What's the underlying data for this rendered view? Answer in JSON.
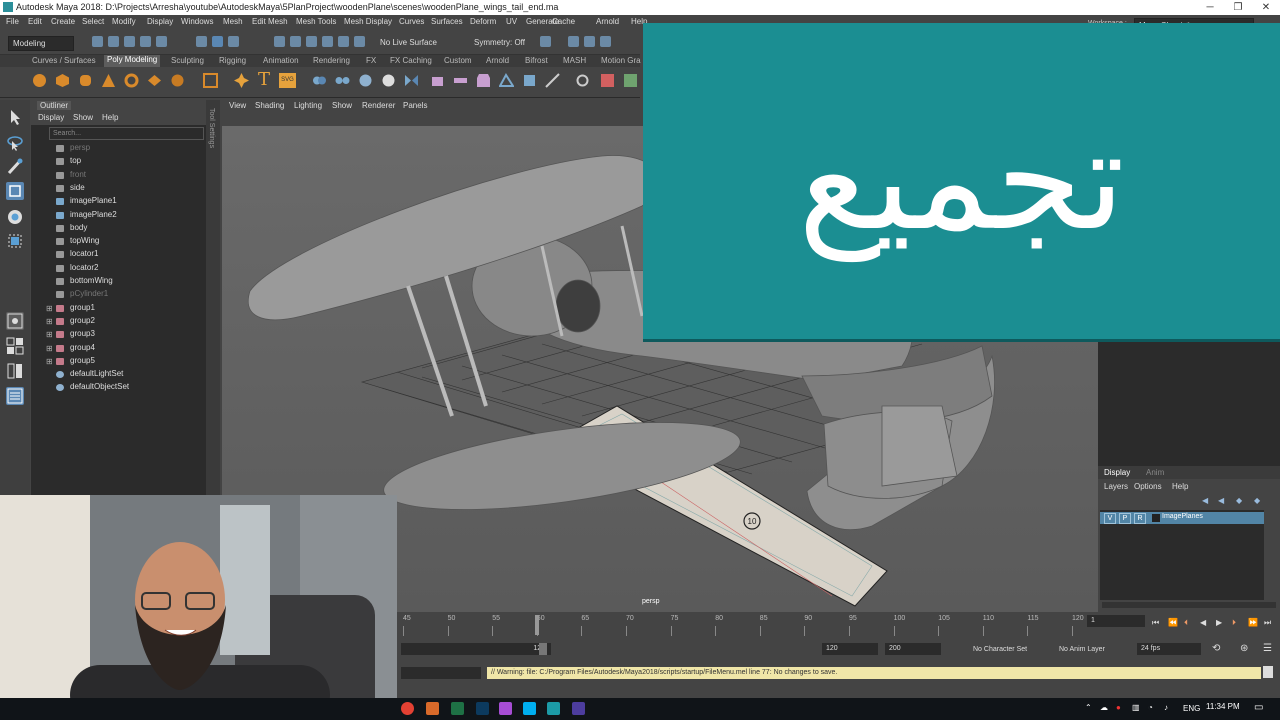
{
  "window": {
    "title": "Autodesk Maya 2018: D:\\Projects\\Arresha\\youtube\\AutodeskMaya\\5PlanProject\\woodenPlane\\scenes\\woodenPlane_wings_tail_end.ma"
  },
  "menubar": {
    "items": [
      "File",
      "Edit",
      "Create",
      "Select",
      "Modify",
      "Display",
      "Windows",
      "Mesh",
      "Edit Mesh",
      "Mesh Tools",
      "Mesh Display",
      "Curves",
      "Surfaces",
      "Deform",
      "UV",
      "Generate",
      "Cache",
      "Arnold",
      "Help"
    ]
  },
  "workspace": {
    "label": "Workspace :",
    "value": "Maya Classic*"
  },
  "toolbar": {
    "mode": "Modeling",
    "live_surface": "No Live Surface",
    "symmetry": "Symmetry: Off"
  },
  "shelf": {
    "tabs": [
      "Curves / Surfaces",
      "Poly Modeling",
      "Sculpting",
      "Rigging",
      "Animation",
      "Rendering",
      "FX",
      "FX Caching",
      "Custom",
      "Arnold",
      "Bifrost",
      "MASH",
      "Motion Gra"
    ],
    "active": "Poly Modeling",
    "svg_label": "SVG",
    "type_label": "T"
  },
  "outliner": {
    "tab": "Outliner",
    "menu": [
      "Display",
      "Show",
      "Help"
    ],
    "search_placeholder": "Search...",
    "items": [
      {
        "name": "persp",
        "icon": "camera-icon",
        "dim": true,
        "expand": false
      },
      {
        "name": "top",
        "icon": "camera-icon",
        "dim": false,
        "expand": false
      },
      {
        "name": "front",
        "icon": "camera-icon",
        "dim": true,
        "expand": false
      },
      {
        "name": "side",
        "icon": "camera-icon",
        "dim": false,
        "expand": false
      },
      {
        "name": "imagePlane1",
        "icon": "image-plane-icon",
        "dim": false,
        "expand": false
      },
      {
        "name": "imagePlane2",
        "icon": "image-plane-icon",
        "dim": false,
        "expand": false
      },
      {
        "name": "body",
        "icon": "mesh-icon",
        "dim": false,
        "expand": false
      },
      {
        "name": "topWing",
        "icon": "mesh-icon",
        "dim": false,
        "expand": false
      },
      {
        "name": "locator1",
        "icon": "locator-icon",
        "dim": false,
        "expand": false
      },
      {
        "name": "locator2",
        "icon": "locator-icon",
        "dim": false,
        "expand": false
      },
      {
        "name": "bottomWing",
        "icon": "mesh-icon",
        "dim": false,
        "expand": false
      },
      {
        "name": "pCylinder1",
        "icon": "mesh-icon",
        "dim": true,
        "expand": false
      },
      {
        "name": "group1",
        "icon": "group-icon",
        "dim": false,
        "expand": true
      },
      {
        "name": "group2",
        "icon": "group-icon",
        "dim": false,
        "expand": true
      },
      {
        "name": "group3",
        "icon": "group-icon",
        "dim": false,
        "expand": true
      },
      {
        "name": "group4",
        "icon": "group-icon",
        "dim": false,
        "expand": true
      },
      {
        "name": "group5",
        "icon": "group-icon",
        "dim": false,
        "expand": true
      },
      {
        "name": "defaultLightSet",
        "icon": "set-icon",
        "dim": false,
        "expand": false
      },
      {
        "name": "defaultObjectSet",
        "icon": "set-icon",
        "dim": false,
        "expand": false
      }
    ],
    "expand_symbol": "⊞"
  },
  "tool_settings_label": "Tool Settings",
  "viewport": {
    "menu": [
      "View",
      "Shading",
      "Lighting",
      "Show",
      "Renderer",
      "Panels"
    ],
    "camera_label": "persp",
    "decal_number": "10"
  },
  "overlay": {
    "text": "تجميع",
    "color": "#1b8e92"
  },
  "layer_editor": {
    "tabs": [
      "Display",
      "Anim"
    ],
    "menu": [
      "Layers",
      "Options",
      "Help"
    ],
    "layer": {
      "v": "V",
      "p": "P",
      "r": "R",
      "name": "ImagePlanes"
    }
  },
  "timeline": {
    "ticks": [
      "45",
      "50",
      "55",
      "60",
      "65",
      "70",
      "75",
      "80",
      "85",
      "90",
      "95",
      "100",
      "105",
      "110",
      "115",
      "120"
    ],
    "current_frame": "1"
  },
  "range": {
    "start": "120",
    "end": "120",
    "max": "200",
    "character_set": "No Character Set",
    "anim_layer": "No Anim Layer",
    "fps": "24 fps"
  },
  "command": {
    "warning": "// Warning: file: C:/Program Files/Autodesk/Maya2018/scripts/startup/FileMenu.mel line 77: No changes to save."
  },
  "taskbar": {
    "lang": "ENG",
    "time": "11:34 PM"
  }
}
